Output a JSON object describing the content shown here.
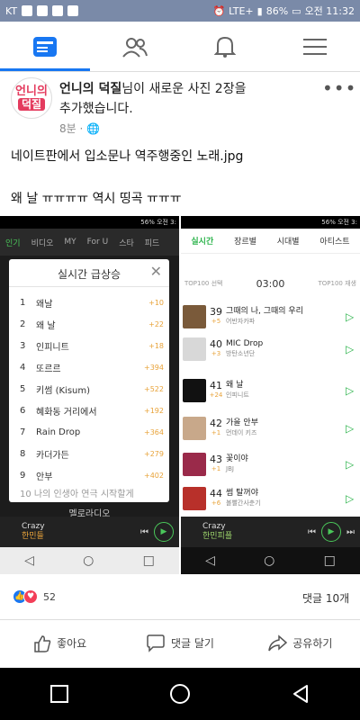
{
  "status": {
    "carrier": "KT",
    "lte": "LTE+",
    "battery": "86%",
    "time": "오전 11:32"
  },
  "post": {
    "author": "언니의 덕질",
    "action_suffix": "님이 새로운 사진 2장을",
    "action_line2": "추가했습니다.",
    "time": "8분 · ",
    "logo_line1": "언니의",
    "logo_line2": "덕질",
    "text_line1": "네이트판에서 입소문나 역주행중인 노래.jpg",
    "text_line2": "왜 날 ㅠㅠㅠㅠ 역시 띵곡 ㅠㅠㅠ"
  },
  "image1": {
    "statusbar": "56% 오전 3:",
    "tabs": [
      "인기",
      "비디오",
      "MY",
      "For U",
      "스타",
      "피드"
    ],
    "popup_title": "실시간 급상승",
    "close": "✕",
    "items": [
      {
        "rank": "1",
        "name": "왜날",
        "change": "+10"
      },
      {
        "rank": "2",
        "name": "왜 날",
        "change": "+22"
      },
      {
        "rank": "3",
        "name": "인피니트",
        "change": "+18"
      },
      {
        "rank": "4",
        "name": "또르르",
        "change": "+394"
      },
      {
        "rank": "5",
        "name": "키썸 (Kisum)",
        "change": "+522"
      },
      {
        "rank": "6",
        "name": "혜화동 거리에서",
        "change": "+192"
      },
      {
        "rank": "7",
        "name": "Rain Drop",
        "change": "+364"
      },
      {
        "rank": "8",
        "name": "카더가든",
        "change": "+279"
      },
      {
        "rank": "9",
        "name": "안부",
        "change": "+402"
      }
    ],
    "partial_row": "10 나의 인생아 연극 시작할게",
    "under_text": "멜로라디오",
    "player_song": "Crazy",
    "player_artist": "한민들",
    "player_tag": "MUSIC"
  },
  "image2": {
    "statusbar": "56% 오전 3:",
    "tabs": [
      "실시간",
      "장르별",
      "시대별",
      "아티스트"
    ],
    "left_sub": "TOP100 선택",
    "time": "03:00",
    "right_sub": "TOP100 재생",
    "items": [
      {
        "rank": "39",
        "change": "+5",
        "title": "그때의 나, 그때의 우리",
        "artist": "어반자카파",
        "color": "#7a5a3a"
      },
      {
        "rank": "40",
        "change": "+3",
        "title": "MIC Drop",
        "artist": "방탄소년단",
        "color": "#d8d8d8"
      },
      {
        "rank": "41",
        "change": "+24",
        "title": "왜 날",
        "artist": "인피니트",
        "color": "#111111"
      },
      {
        "rank": "42",
        "change": "+1",
        "title": "가을 안부",
        "artist": "먼데이 키즈",
        "color": "#c8a88a"
      },
      {
        "rank": "43",
        "change": "+1",
        "title": "꽃이야",
        "artist": "JBJ",
        "color": "#9a2a4a"
      },
      {
        "rank": "44",
        "change": "+6",
        "title": "썸 탈꺼야",
        "artist": "볼빨간사춘기",
        "color": "#b8302a"
      }
    ],
    "player_song": "Crazy",
    "player_artist": "한민피플",
    "player_tag": "MUSIC"
  },
  "footer": {
    "reactions": "52",
    "comments": "댓글 10개",
    "like": "좋아요",
    "comment": "댓글 달기",
    "share": "공유하기"
  },
  "colors": {
    "fb_blue": "#1877f2",
    "melon_green": "#2ab34a",
    "change_orange": "#e8a33a"
  }
}
